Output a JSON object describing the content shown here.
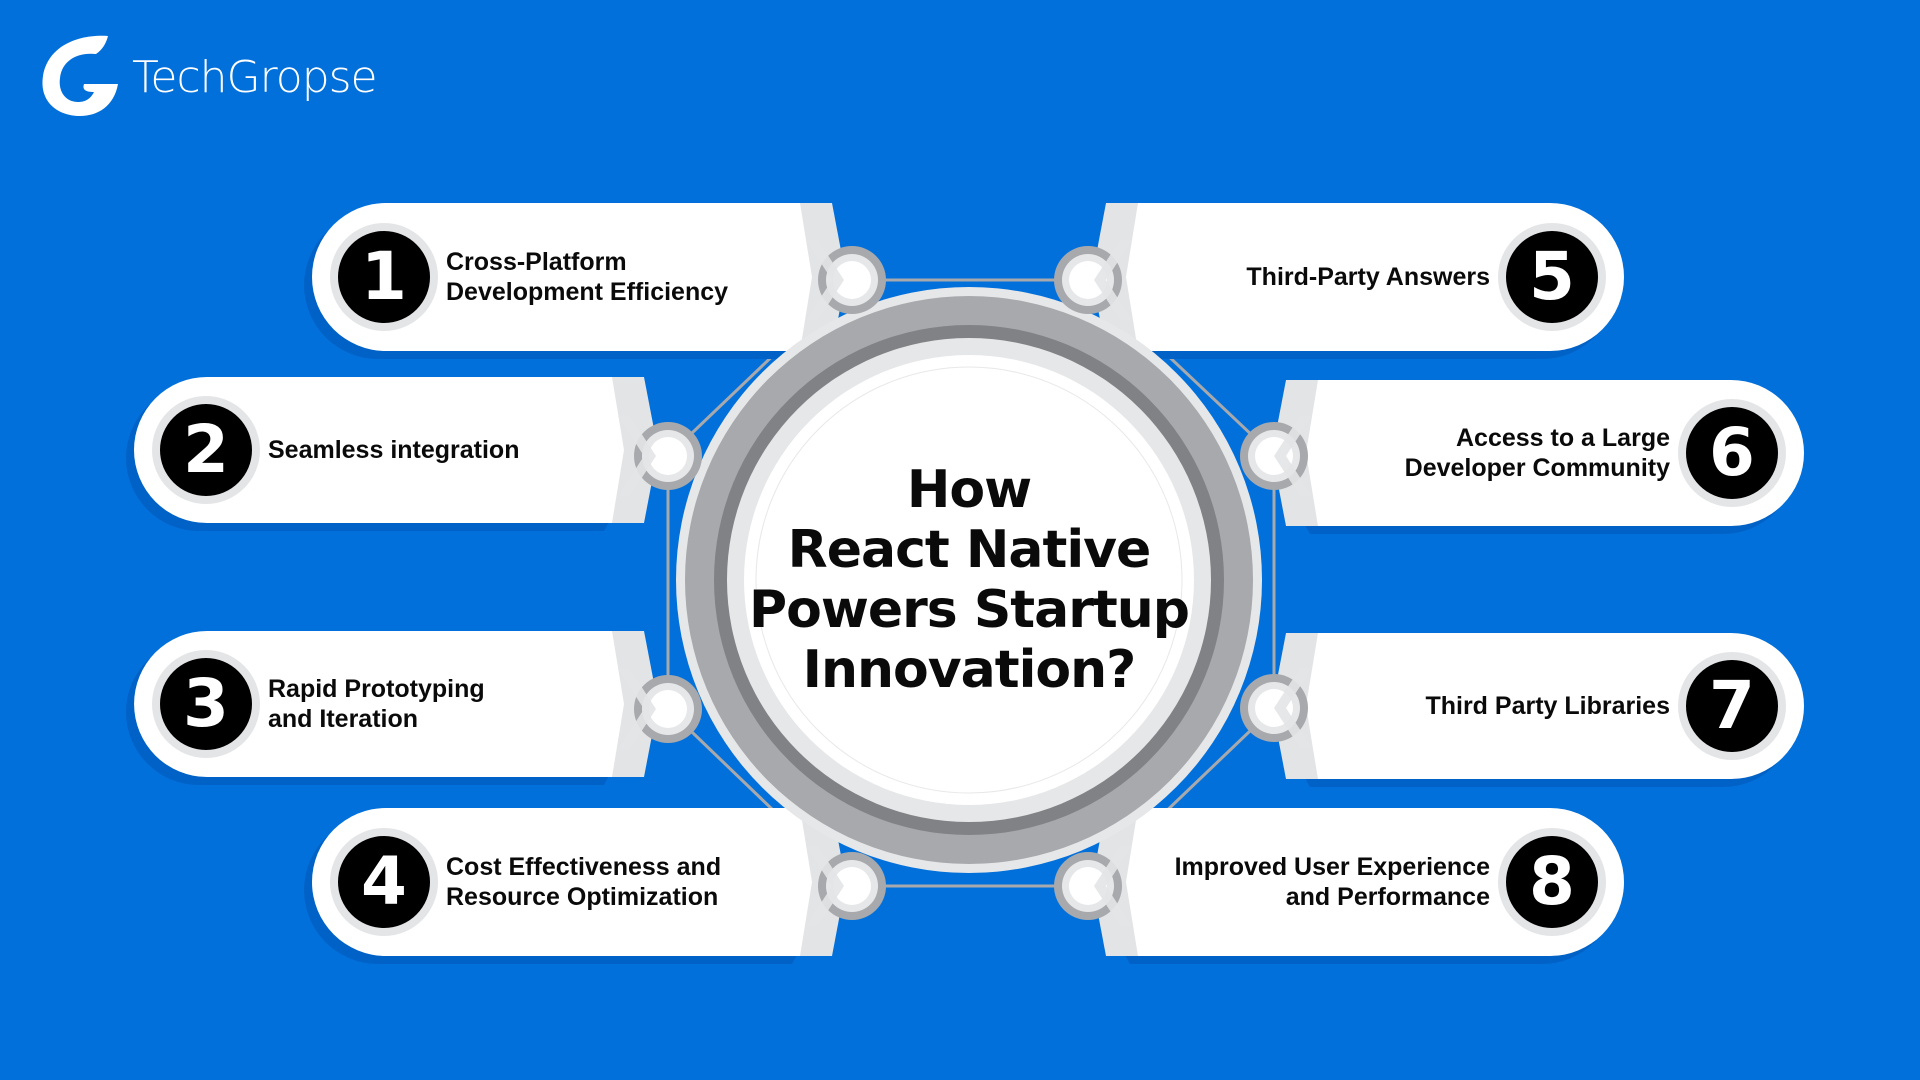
{
  "brand": {
    "name": "TechGropse",
    "logo_icon": "g-letter-logo-icon"
  },
  "colors": {
    "background": "#0270DB",
    "shadow": "#0062C6",
    "pill": "#FFFFFF",
    "pill_band": "#E3E4E6",
    "badge": "#000000",
    "badge_ring": "#E4E5E7",
    "ring_outer": "#E6E7E8",
    "ring_mid": "#A7A9AC",
    "ring_dark": "#808285",
    "connector": "#A7A9AC",
    "text": "#0A0A0A"
  },
  "center": {
    "title": "How\nReact Native\nPowers Startup\nInnovation?"
  },
  "items": [
    {
      "number": "1",
      "label": "Cross-Platform\nDevelopment Efficiency",
      "side": "left"
    },
    {
      "number": "2",
      "label": "Seamless integration",
      "side": "left"
    },
    {
      "number": "3",
      "label": "Rapid Prototyping\nand Iteration",
      "side": "left"
    },
    {
      "number": "4",
      "label": "Cost Effectiveness and\nResource Optimization",
      "side": "left"
    },
    {
      "number": "5",
      "label": "Third-Party Answers",
      "side": "right"
    },
    {
      "number": "6",
      "label": "Access to a Large\nDeveloper Community",
      "side": "right"
    },
    {
      "number": "7",
      "label": "Third Party Libraries",
      "side": "right"
    },
    {
      "number": "8",
      "label": "Improved User Experience\nand Performance",
      "side": "right"
    }
  ]
}
